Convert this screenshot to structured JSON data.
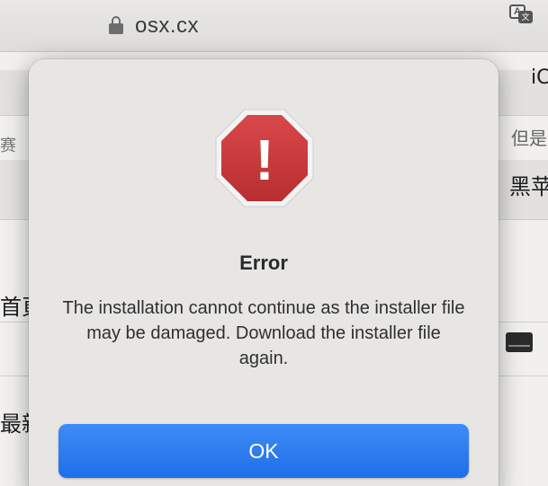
{
  "browser": {
    "url": "osx.cx",
    "lock_icon": "lock-icon",
    "translate_icon": "translate-icon",
    "translate_glyph_a": "A",
    "translate_glyph_b": "文"
  },
  "background_page": {
    "fragments": [
      "赛",
      "iC",
      "但是",
      "黑苹",
      "首頁",
      "最新"
    ]
  },
  "dialog": {
    "icon": "stop-sign-icon",
    "icon_glyph": "!",
    "title": "Error",
    "message": "The installation cannot continue as the installer file may be damaged. Download the installer file again.",
    "ok_label": "OK"
  },
  "colors": {
    "stop_sign": "#cc3a3a",
    "button": "#2a7af0"
  }
}
